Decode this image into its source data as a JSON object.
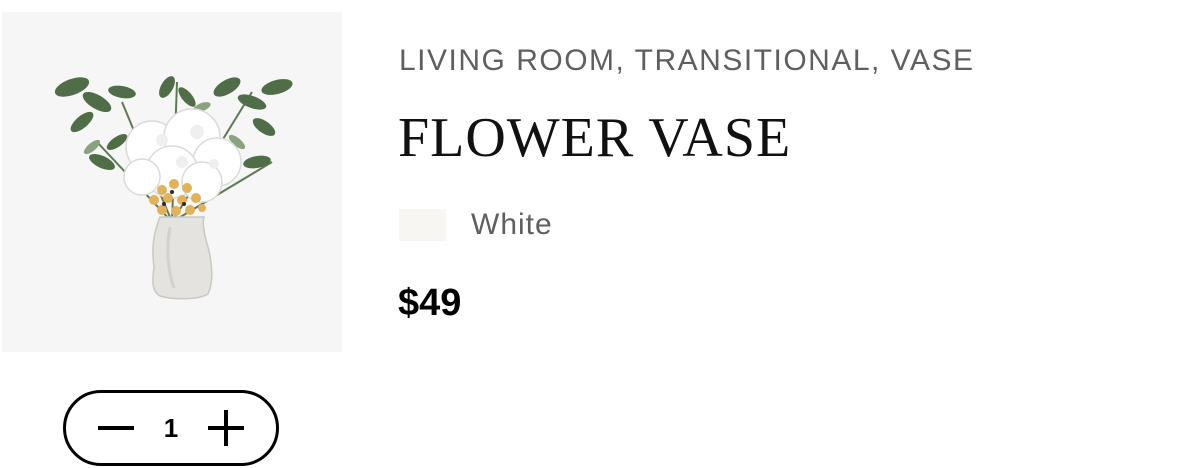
{
  "product": {
    "categories": "LIVING ROOM, TRANSITIONAL, VASE",
    "title": "FLOWER VASE",
    "variant": {
      "label": "White",
      "swatch_color": "#f7f6f3"
    },
    "price": "$49",
    "quantity": "1",
    "image_icon": "flower-vase-image"
  },
  "stepper": {
    "decrement_icon": "minus-icon",
    "increment_icon": "plus-icon"
  }
}
